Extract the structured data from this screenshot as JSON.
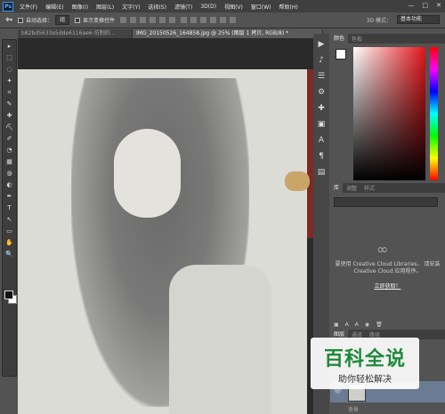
{
  "app": {
    "logo": "Ps"
  },
  "menu": [
    "文件(F)",
    "编辑(E)",
    "图像(I)",
    "图层(L)",
    "文字(Y)",
    "选择(S)",
    "滤镜(T)",
    "3D(D)",
    "视图(V)",
    "窗口(W)",
    "帮助(H)"
  ],
  "window_controls": [
    "—",
    "□",
    "✕"
  ],
  "options": {
    "auto_select_label": "自动选择：",
    "auto_select_value": "组",
    "show_transform_label": "显示变换控件",
    "mode_3d": "3D 模式：",
    "workspace": "基本功能"
  },
  "tabs": [
    {
      "label": "b82bd5633e5dde6116ae6-仿制的...",
      "active": false
    },
    {
      "label": "IMG_20150526_164858.jpg @ 25% (图层 1 拷贝, RGB/8) *",
      "active": true
    }
  ],
  "tools": [
    "▸",
    "⬚",
    "◌",
    "✦",
    "⌗",
    "✎",
    "✚",
    "⛏",
    "✐",
    "◔",
    "▦",
    "◍",
    "◐",
    "✒",
    "T",
    "↖",
    "▭",
    "✋",
    "🔍"
  ],
  "right_icons": [
    "▶",
    "♪",
    "☰",
    "⚙",
    "✚",
    "▣",
    "A",
    "¶",
    "▤"
  ],
  "color_panel": {
    "tabs": [
      "颜色",
      "色板"
    ]
  },
  "libraries_panel": {
    "tabs": [
      "库",
      "调整",
      "样式"
    ],
    "message": "要使用 Creative Cloud Libraries， 请安装 Creative Cloud 应用程序。",
    "link": "立即获取！"
  },
  "layers_panel": {
    "tabs": [
      "图层",
      "通道",
      "路径"
    ],
    "background_label": "背景"
  },
  "watermark": {
    "title": "百科全说",
    "subtitle": "助你轻松解决"
  }
}
